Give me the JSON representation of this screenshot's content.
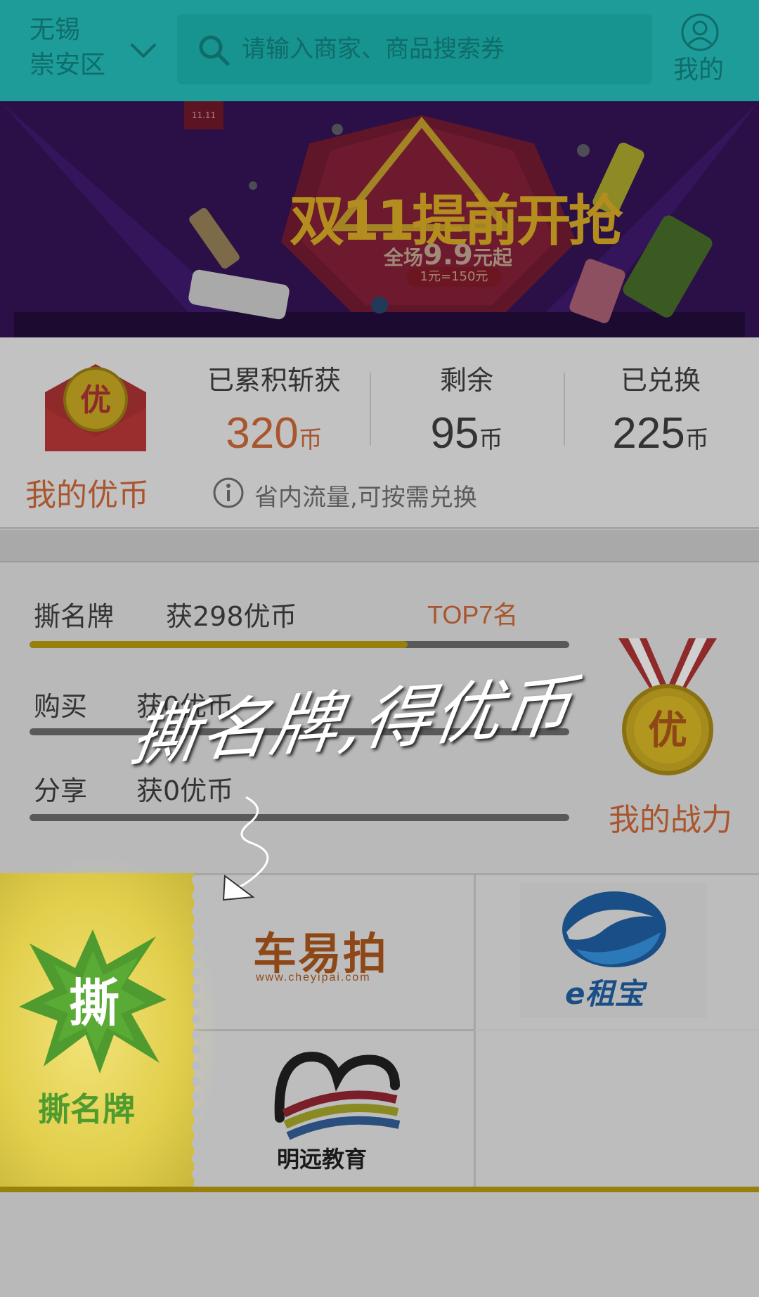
{
  "header": {
    "city": "无锡",
    "district": "崇安区",
    "search_placeholder": "请输入商家、商品搜索券",
    "mine_label": "我的"
  },
  "banner": {
    "badge": "11.11",
    "title": "双11提前开抢",
    "subtitle_prefix": "全场",
    "subtitle_price": "9.9",
    "subtitle_suffix": "元起",
    "rate": "1元=150元"
  },
  "coins": {
    "label": "我的优币",
    "envelope_char": "优",
    "accumulated": {
      "title": "已累积斩获",
      "value": "320",
      "unit": "币"
    },
    "remaining": {
      "title": "剩余",
      "value": "95",
      "unit": "币"
    },
    "exchanged": {
      "title": "已兑换",
      "value": "225",
      "unit": "币"
    },
    "note": "省内流量,可按需兑换"
  },
  "tasks": [
    {
      "name": "撕名牌",
      "reward": "获298优币",
      "rank": "TOP7名",
      "progress": 0.7
    },
    {
      "name": "购买",
      "reward": "获0优币",
      "rank": "",
      "progress": 0
    },
    {
      "name": "分享",
      "reward": "获0优币",
      "rank": "",
      "progress": 0
    }
  ],
  "medal": {
    "char": "优",
    "label": "我的战力"
  },
  "overlay": {
    "title": "撕名牌,得优币"
  },
  "tear": {
    "char": "撕",
    "label": "撕名牌"
  },
  "brands": {
    "cheyipai": {
      "name": "车易拍",
      "url": "www.cheyipai.com"
    },
    "ezubao": {
      "name": "e租宝"
    },
    "mingyuan": {
      "name": "明远教育"
    }
  },
  "colors": {
    "header": "#1d9c9a",
    "accent_orange": "#a9562e",
    "progress_gold": "#97800c",
    "tear_green": "#4f9b2f"
  }
}
